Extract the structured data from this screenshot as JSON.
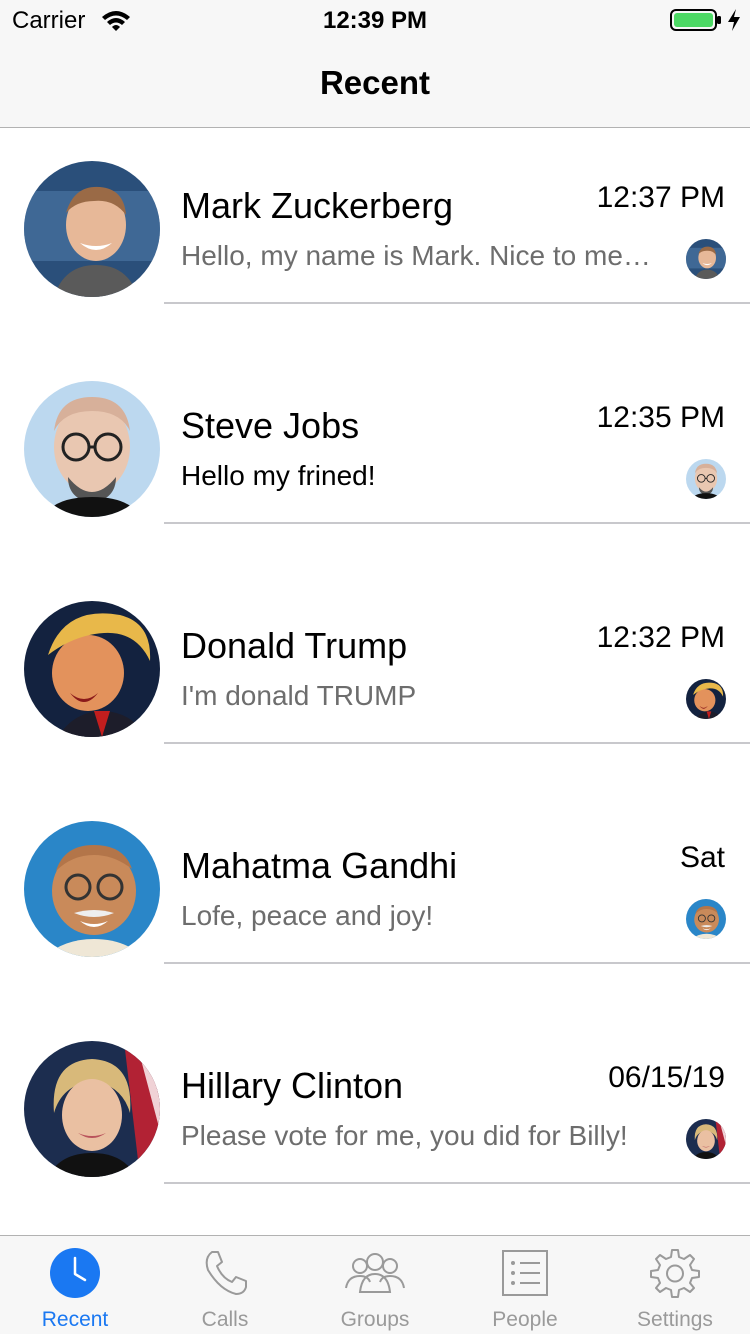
{
  "status_bar": {
    "carrier": "Carrier",
    "time": "12:39 PM",
    "battery_color": "#4cd964"
  },
  "nav": {
    "title": "Recent"
  },
  "chats": [
    {
      "name": "Mark Zuckerberg",
      "time": "12:37 PM",
      "preview": "Hello, my name is Mark. Nice to meet you",
      "unread": false,
      "avatar": "mark-zuckerberg-avatar"
    },
    {
      "name": "Steve Jobs",
      "time": "12:35 PM",
      "preview": "Hello my frined!",
      "unread": true,
      "avatar": "steve-jobs-avatar"
    },
    {
      "name": "Donald Trump",
      "time": "12:32 PM",
      "preview": "I'm donald TRUMP",
      "unread": false,
      "avatar": "donald-trump-avatar"
    },
    {
      "name": "Mahatma Gandhi",
      "time": "Sat",
      "preview": "Lofe, peace and joy!",
      "unread": false,
      "avatar": "mahatma-gandhi-avatar"
    },
    {
      "name": "Hillary Clinton",
      "time": "06/15/19",
      "preview": "Please vote for me, you did for Billy!",
      "unread": false,
      "avatar": "hillary-clinton-avatar"
    }
  ],
  "tabs": [
    {
      "label": "Recent",
      "icon": "clock-icon",
      "active": true
    },
    {
      "label": "Calls",
      "icon": "phone-icon",
      "active": false
    },
    {
      "label": "Groups",
      "icon": "group-icon",
      "active": false
    },
    {
      "label": "People",
      "icon": "list-icon",
      "active": false
    },
    {
      "label": "Settings",
      "icon": "gear-icon",
      "active": false
    }
  ],
  "colors": {
    "accent": "#1a78f2",
    "tab_inactive": "#9a9a9a",
    "preview_text": "#6d6d6d"
  }
}
